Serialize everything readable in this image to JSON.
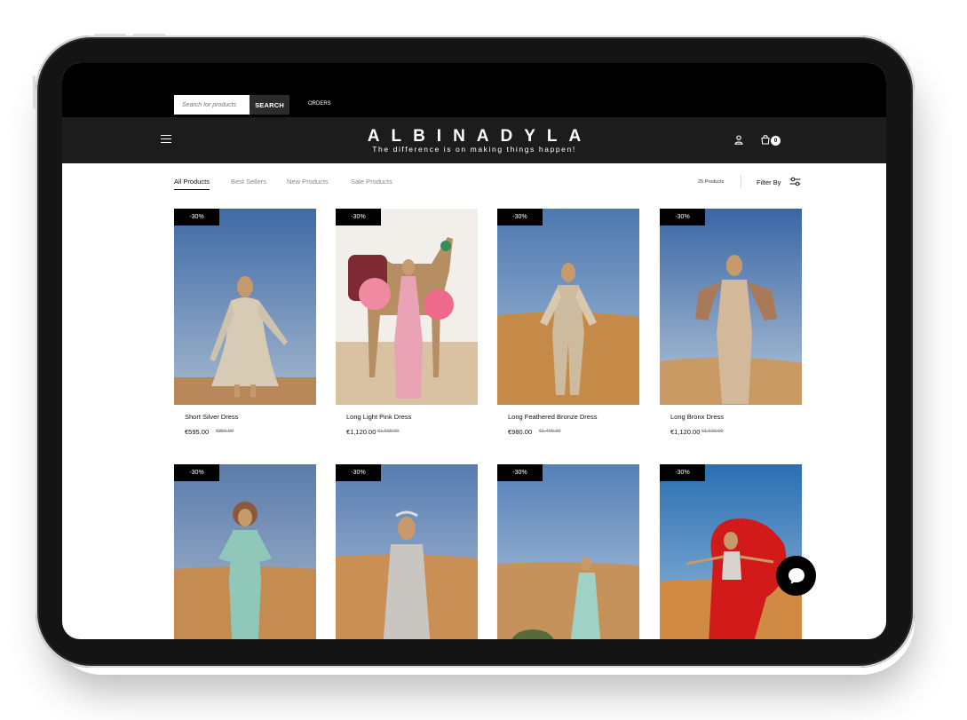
{
  "header": {
    "search_placeholder": "Search for products",
    "search_button": "SEARCH",
    "orders_link": "ORDERS",
    "brand": "ALBINADYLA",
    "tagline": "The difference is on making things happen!",
    "cart_count": "0",
    "icons": [
      "hamburger-menu-icon",
      "user-icon",
      "shopping-bag-icon"
    ]
  },
  "toolbar": {
    "tabs": [
      {
        "label": "All Products",
        "active": true
      },
      {
        "label": "Best Sellers",
        "active": false
      },
      {
        "label": "New Products",
        "active": false
      },
      {
        "label": "Sale Products",
        "active": false
      }
    ],
    "product_count": "25 Products",
    "filter_label": "Filter By",
    "filter_icon": "sliders-icon"
  },
  "products": [
    {
      "badge": "-30%",
      "name": "Short Silver Dress",
      "price": "€595.00",
      "old_price": "€850.00"
    },
    {
      "badge": "-30%",
      "name": "Long Light Pink Dress",
      "price": "€1,120.00",
      "old_price": "€1,600.00"
    },
    {
      "badge": "-30%",
      "name": "Long Feathered Bronze Dress",
      "price": "€980.00",
      "old_price": "€1,400.00"
    },
    {
      "badge": "-30%",
      "name": "Long Bronx Dress",
      "price": "€1,120.00",
      "old_price": "€1,600.00"
    },
    {
      "badge": "-30%"
    },
    {
      "badge": "-30%"
    },
    {
      "badge": "-30%"
    },
    {
      "badge": "-30%"
    }
  ],
  "chat": {
    "icon": "chat-bubble-icon"
  },
  "colors": {
    "topbar": "#000000",
    "navbar": "#1c1c1d",
    "badge": "#000000",
    "sky": "#5a7fb0",
    "sand": "#c9955a"
  }
}
